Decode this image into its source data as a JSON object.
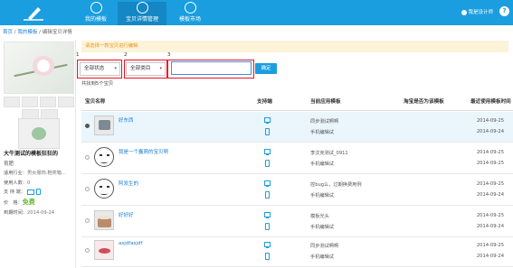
{
  "header": {
    "nav": [
      {
        "label": "我的模板",
        "icon": "template-icon"
      },
      {
        "label": "宝贝详情管理",
        "icon": "grid-icon"
      },
      {
        "label": "模板市场",
        "icon": "market-icon"
      }
    ],
    "designer_link": "我是设计师",
    "help": "?"
  },
  "breadcrumb": {
    "home": "首页",
    "sep1": " / ",
    "mine": "我的模板",
    "sep2": " / ",
    "current": "编辑宝贝详情"
  },
  "sidebar": {
    "title": "大牛测试的模板狂狂的",
    "subtitle": "育肥",
    "info": {
      "industry_label": "适用行业：",
      "industry": "男女服饰,鞋类箱...",
      "users_label": "使用人数：",
      "users": "0",
      "support_label": "支 持 端：",
      "price_label": "价　格：",
      "price": "免费",
      "expire_label": "到期时间：",
      "expire": "2014-09-24"
    }
  },
  "notice": "请选择一款宝贝进行编辑",
  "filters": {
    "markers": [
      "1",
      "2",
      "3"
    ],
    "status": "全部状态",
    "category": "全部类目",
    "search_value": "",
    "confirm": "确定"
  },
  "count": "共找到5个宝贝",
  "table": {
    "headers": [
      "宝贝名称",
      "支持端",
      "当前应用模板",
      "淘宝是否为该模板",
      "最近使用模板时间"
    ],
    "rows": [
      {
        "name": "好东西",
        "selected": true,
        "thumb": "photo",
        "tpl_pc": "同步测试啊啊",
        "tpl_mobile": "手机编辑试",
        "date1": "2014-09-25",
        "date2": "2014-09-24"
      },
      {
        "name": "我是一个蠢萌的宝贝啊",
        "selected": false,
        "thumb": "face",
        "tpl_pc": "李汶克测试_0911",
        "tpl_mobile": "手机编辑试",
        "date1": "2014-09-25",
        "date2": "2014-09-25"
      },
      {
        "name": "阿发生的",
        "selected": false,
        "thumb": "face",
        "tpl_pc": "控bug么，过期换费用例",
        "tpl_mobile": "手机编辑试",
        "date1": "2014-09-25",
        "date2": "2014-09-24"
      },
      {
        "name": "好好好",
        "selected": false,
        "thumb": "cake",
        "tpl_pc": "模板光头",
        "tpl_mobile": "手机编辑试",
        "date1": "2014-09-25",
        "date2": "2014-09-24"
      },
      {
        "name": "asjdfasjdf",
        "selected": false,
        "thumb": "lips",
        "tpl_pc": "同步测试啊啊",
        "tpl_mobile": "手机编辑试",
        "date1": "2014-09-25",
        "date2": "2014-09-24"
      }
    ]
  }
}
